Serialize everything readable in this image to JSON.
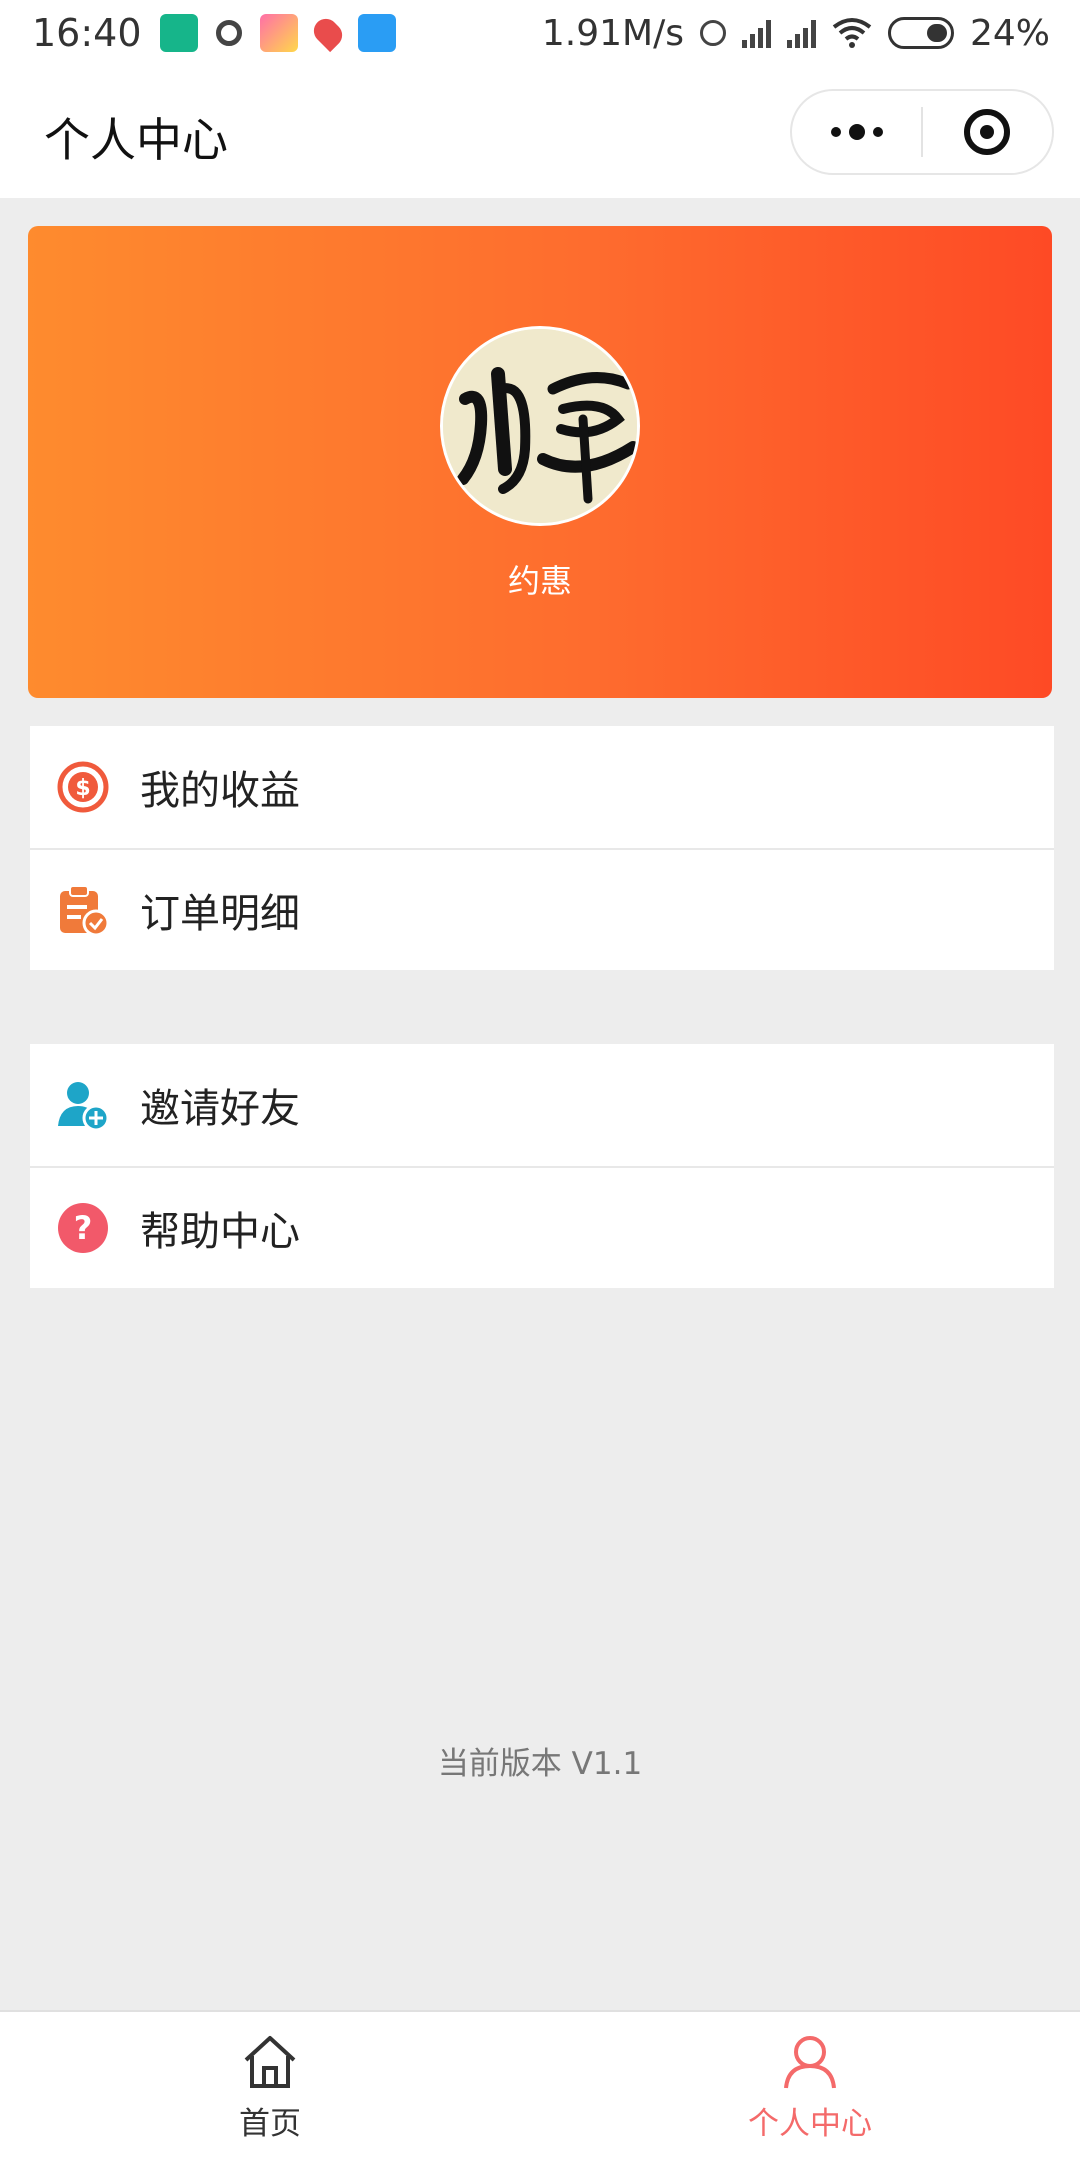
{
  "status_bar": {
    "time": "16:40",
    "net_speed": "1.91M/s",
    "battery": "24%",
    "icons": [
      "shield-app-icon",
      "chat-app-icon",
      "photo-app-icon",
      "map-app-icon",
      "weather-app-icon",
      "hd-icon",
      "signal-icon",
      "signal-icon",
      "wifi-icon",
      "battery-icon"
    ]
  },
  "nav": {
    "title": "个人中心",
    "more_icon": "more-dots-icon",
    "close_icon": "target-close-icon"
  },
  "profile": {
    "username": "约惠",
    "avatar_icon": "calligraphy-avatar",
    "gradient_start": "#fe8b2e",
    "gradient_end": "#fe4a25"
  },
  "menu_group_1": [
    {
      "label": "我的收益",
      "icon": "dollar-circle-icon",
      "color": "#f05a3c"
    },
    {
      "label": "订单明细",
      "icon": "clipboard-check-icon",
      "color": "#f07a3a"
    }
  ],
  "menu_group_2": [
    {
      "label": "邀请好友",
      "icon": "add-user-icon",
      "color": "#1ea5c8"
    },
    {
      "label": "帮助中心",
      "icon": "question-circle-icon",
      "color": "#f2596a"
    }
  ],
  "version": "当前版本 V1.1",
  "tabs": [
    {
      "label": "首页",
      "icon": "home-icon",
      "active": false
    },
    {
      "label": "个人中心",
      "icon": "person-icon",
      "active": true,
      "color": "#f46a6a"
    }
  ]
}
